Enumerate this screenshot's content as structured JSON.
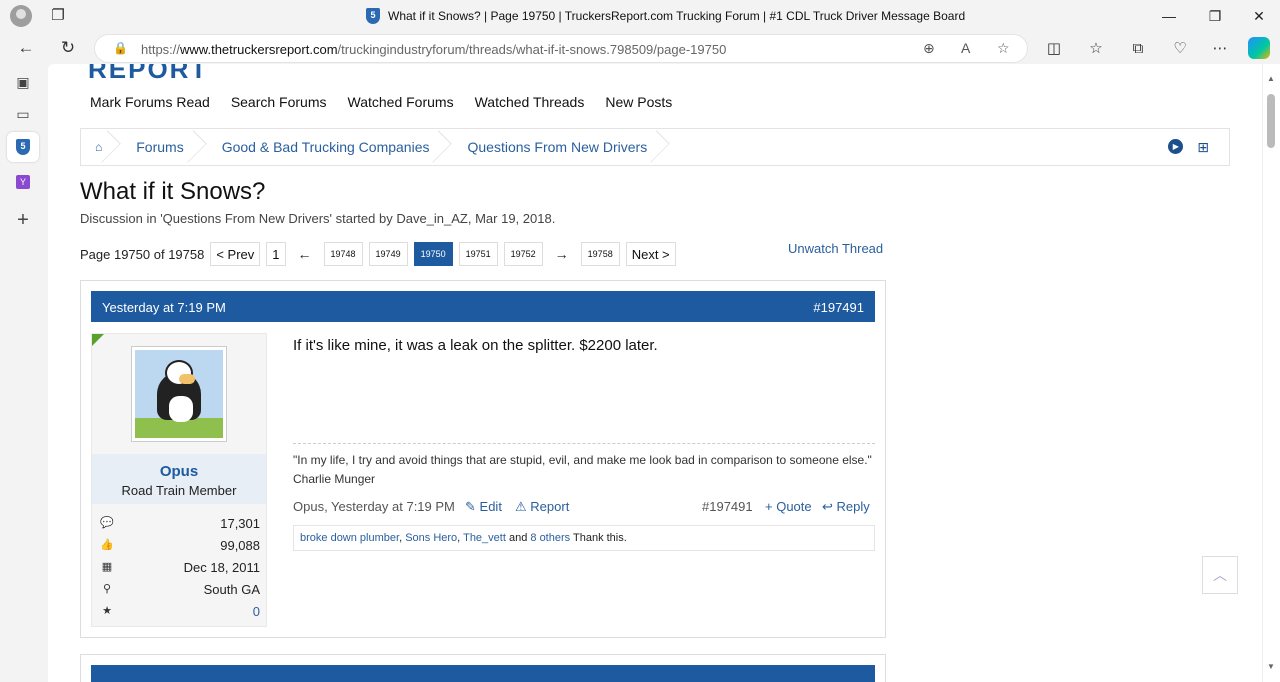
{
  "browser": {
    "tab_title": "What if it Snows? | Page 19750 | TruckersReport.com Trucking Forum | #1 CDL Truck Driver Message Board",
    "url_prefix": "https://",
    "url_host": "www.thetruckersreport.com",
    "url_path": "/truckingindustryforum/threads/what-if-it-snows.798509/page-19750"
  },
  "site": {
    "logo_text": "REPORT"
  },
  "topnav": [
    "Mark Forums Read",
    "Search Forums",
    "Watched Forums",
    "Watched Threads",
    "New Posts"
  ],
  "breadcrumb": [
    "Forums",
    "Good & Bad Trucking Companies",
    "Questions From New Drivers"
  ],
  "thread": {
    "title": "What if it Snows?",
    "meta": "Discussion in 'Questions From New Drivers' started by Dave_in_AZ, Mar 19, 2018.",
    "page_label": "Page 19750 of 19758",
    "prev": "< Prev",
    "next": "Next >",
    "first": "1",
    "last": "19758",
    "pages": [
      "19748",
      "19749",
      "19750",
      "19751",
      "19752"
    ],
    "current_page": "19750",
    "left_arrow": "←",
    "right_arrow": "→",
    "unwatch": "Unwatch Thread"
  },
  "post": {
    "date": "Yesterday at 7:19 PM",
    "number": "#197491",
    "username": "Opus",
    "user_title": "Road Train Member",
    "stats": [
      {
        "icon": "messages-icon",
        "glyph": "💬",
        "value": "17,301"
      },
      {
        "icon": "thumbs-up-icon",
        "glyph": "👍",
        "value": "99,088"
      },
      {
        "icon": "calendar-icon",
        "glyph": "▦",
        "value": "Dec 18, 2011"
      },
      {
        "icon": "location-icon",
        "glyph": "⚲",
        "value": "South GA"
      },
      {
        "icon": "star-icon",
        "glyph": "★",
        "value": "0"
      }
    ],
    "message": "If it's like mine, it was a leak on the splitter. $2200 later.",
    "signature_quote": "\"In my life, I try and avoid things that are stupid, evil, and make me look bad in comparison to someone else.\"",
    "signature_author": "Charlie Munger",
    "footer_by": "Opus, Yesterday at 7:19 PM",
    "edit": "Edit",
    "report": "Report",
    "footer_number": "#197491",
    "quote": "+ Quote",
    "reply": "Reply",
    "likes": {
      "users": [
        "broke down plumber",
        "Sons Hero",
        "The_vett"
      ],
      "and": "and",
      "others": "8 others",
      "suffix": "Thank this."
    }
  },
  "colors": {
    "accent": "#1d5aa0",
    "link": "#2a5f9e"
  }
}
